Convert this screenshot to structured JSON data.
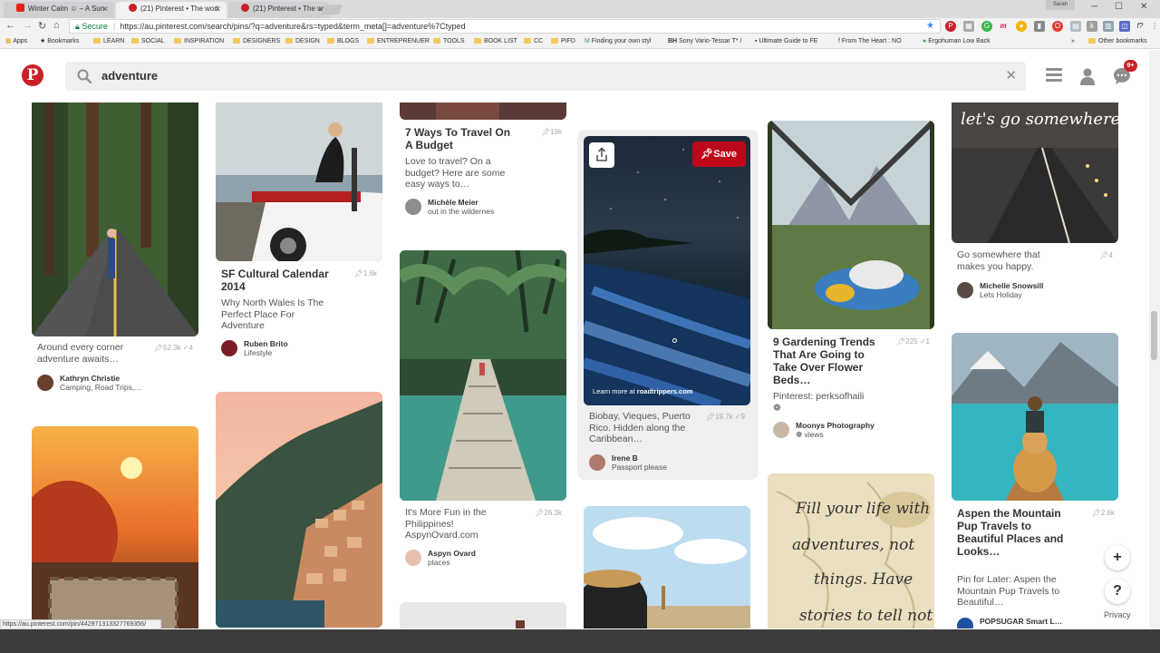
{
  "browser": {
    "tabs": [
      {
        "label": "Winter Calm ☺ – A Sun",
        "active": false
      },
      {
        "label": "(21) Pinterest • The worl",
        "active": true
      },
      {
        "label": "(21) Pinterest • The worl",
        "active": false
      }
    ],
    "profile_label": "Sarah",
    "secure_label": "Secure",
    "url": "https://au.pinterest.com/search/pins/?q=adventure&rs=typed&term_meta[]=adventure%7Ctyped",
    "bookmarks": [
      "Apps",
      "Bookmarks",
      "LEARN",
      "SOCIAL",
      "INSPIRATION",
      "DESIGNERS",
      "DESIGN",
      "BLOGS",
      "ENTREPRENUER",
      "TOOLS",
      "BOOK LIST",
      "CC",
      "PIFD",
      "Finding your own styl",
      "Sony Vario-Tessar T* /",
      "Ultimate Guide to FE",
      "From The Heart : NO",
      "Ergohuman Low Back"
    ],
    "other_bookmarks": "Other bookmarks",
    "status_url": "https://au.pinterest.com/pin/442971313327769356/"
  },
  "pinterest": {
    "logo": "P",
    "search_query": "adventure",
    "notification_count": "9+",
    "accent": "#bd081c"
  },
  "pins": {
    "p1": {
      "desc": "Around every corner adventure awaits…",
      "repins": "52.3k",
      "likes": "4",
      "user": "Kathryn Christie",
      "board": "Camping, Road Trips,…"
    },
    "p2": {
      "title": "SF Cultural Calendar 2014",
      "desc": "Why North Wales Is The Perfect Place For Adventure",
      "repins": "1.6k",
      "user": "Ruben Brito",
      "board": "Lifestyle"
    },
    "p3": {
      "title": "7 Ways To Travel On A Budget",
      "desc": "Love to travel? On a budget? Here are some easy ways to…",
      "repins": "19k",
      "user": "Michèle Meier",
      "board": "out in the wildernes"
    },
    "p4": {
      "desc": "It's More Fun in the Philippines! AspynOvard.com",
      "repins": "26.3k",
      "user": "Aspyn Ovard",
      "board": "places"
    },
    "p5": {
      "desc": "Biobay, Vieques, Puerto Rico. Hidden along the Caribbean…",
      "repins": "19.7k",
      "likes": "9",
      "user": "Irene B",
      "board": "Passport please",
      "save": "Save",
      "learn_more": "Learn more at",
      "learn_more_site": "roadtrippers.com"
    },
    "p6": {
      "title": "9 Gardening Trends That Are Going to Take Over Flower Beds…",
      "desc": "Pinterest: perksofhaili",
      "glyph": "❁",
      "repins": "225",
      "likes": "1",
      "user": "Moonys Photography",
      "board": "❁ views"
    },
    "p7": {
      "desc": "Go somewhere that makes you happy.",
      "repins": "4",
      "user": "Michelle Snowsill",
      "board": "Lets Holiday",
      "image_text": "let's go somewhere."
    },
    "p8": {
      "title": "Aspen the Mountain Pup Travels to Beautiful Places and Looks…",
      "desc": "Pin for Later: Aspen the Mountain Pup Travels to Beautiful…",
      "repins": "2.6k",
      "user": "POPSUGAR Smart L…"
    },
    "p9": {
      "image_text_1": "Fill your life with",
      "image_text_2": "adventures, not",
      "image_text_3": "things. Have",
      "image_text_4": "stories to tell not"
    }
  },
  "floating": {
    "add": "+",
    "help": "?",
    "privacy": "Privacy"
  }
}
